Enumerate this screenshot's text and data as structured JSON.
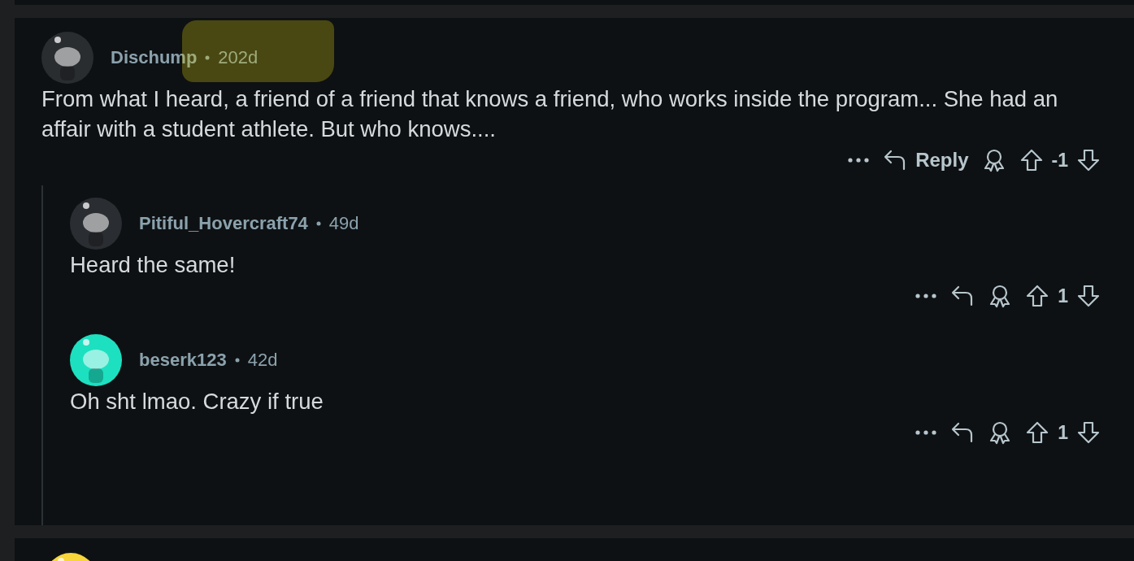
{
  "comment": {
    "author": "Dischump",
    "age": "202d",
    "highlighted": true,
    "avatar": {
      "color": "#2a2d30"
    },
    "body": "From what I heard, a friend of a friend that knows a friend, who works inside the program... She had an affair with a student athlete. But who knows....",
    "reply_label": "Reply",
    "score": "-1",
    "replies": [
      {
        "author": "Pitiful_Hovercraft74",
        "age": "49d",
        "avatar": {
          "color": "#2a2d31"
        },
        "body": "Heard the same!",
        "score": "1"
      },
      {
        "author": "beserk123",
        "age": "42d",
        "avatar": {
          "color": "#1de0c0"
        },
        "body": "Oh sht lmao. Crazy if true",
        "score": "1"
      }
    ]
  },
  "next_comment": {
    "avatar": {
      "color": "#f7d53b"
    }
  }
}
